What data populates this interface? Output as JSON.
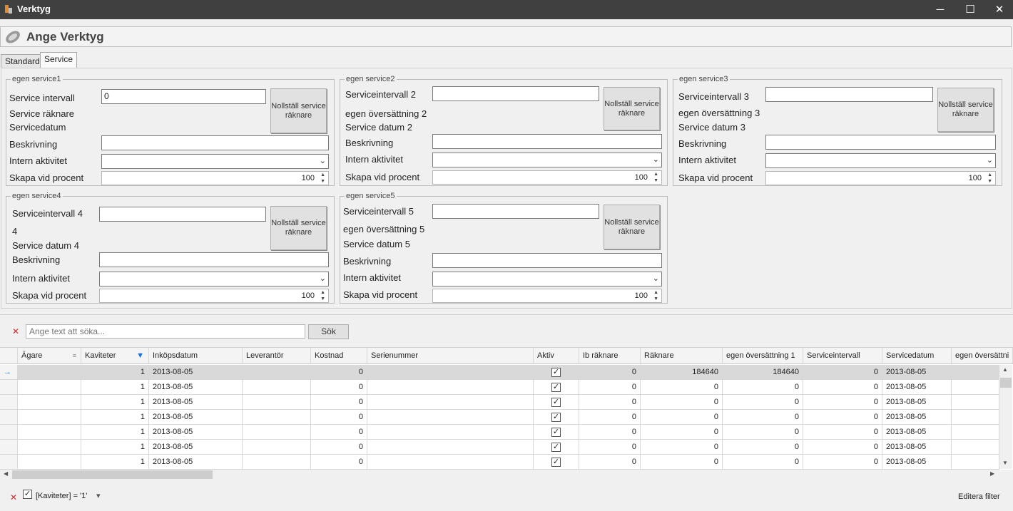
{
  "window": {
    "title": "Verktyg",
    "minimize": "─",
    "maximize": "☐",
    "close": "✕"
  },
  "header": {
    "title": "Ange Verktyg"
  },
  "tabs": [
    {
      "label": "Standard",
      "active": false
    },
    {
      "label": "Service",
      "active": true
    }
  ],
  "groups": {
    "g1": {
      "legend": "egen service1",
      "interval_label": "Service intervall",
      "interval_value": "0",
      "counter_label": "Service räknare",
      "date_label": "Servicedatum",
      "desc_label": "Beskrivning",
      "activity_label": "Intern aktivitet",
      "percent_label": "Skapa vid procent",
      "percent_value": "100",
      "reset_button": "Nollställ service räknare"
    },
    "g2": {
      "legend": "egen service2",
      "interval_label": "Serviceintervall 2",
      "interval_value": "",
      "counter_label": "egen översättning 2",
      "date_label": "Service datum 2",
      "desc_label": "Beskrivning",
      "activity_label": "Intern aktivitet",
      "percent_label": "Skapa vid procent",
      "percent_value": "100",
      "reset_button": "Nollställ service räknare"
    },
    "g3": {
      "legend": "egen service3",
      "interval_label": "Serviceintervall 3",
      "interval_value": "",
      "counter_label": "egen översättning 3",
      "date_label": "Service datum 3",
      "desc_label": "Beskrivning",
      "activity_label": "Intern aktivitet",
      "percent_label": "Skapa vid procent",
      "percent_value": "100",
      "reset_button": "Nollställ service räknare"
    },
    "g4": {
      "legend": "egen service4",
      "interval_label": "Serviceintervall 4",
      "interval_value": "",
      "counter_label": "4",
      "date_label": "Service datum 4",
      "desc_label": "Beskrivning",
      "activity_label": "Intern aktivitet",
      "percent_label": "Skapa vid procent",
      "percent_value": "100",
      "reset_button": "Nollställ service räknare"
    },
    "g5": {
      "legend": "egen service5",
      "interval_label": "Serviceintervall 5",
      "interval_value": "",
      "counter_label": "egen översättning 5",
      "date_label": "Service datum 5",
      "desc_label": "Beskrivning",
      "activity_label": "Intern aktivitet",
      "percent_label": "Skapa vid procent",
      "percent_value": "100",
      "reset_button": "Nollställ service räknare"
    }
  },
  "search": {
    "placeholder": "Ange text att söka...",
    "button": "Sök",
    "clear_icon": "✕"
  },
  "grid": {
    "columns": [
      "Ägare",
      "Kaviteter",
      "Inköpsdatum",
      "Leverantör",
      "Kostnad",
      "Serienummer",
      "Aktiv",
      "Ib räknare",
      "Räknare",
      "egen översättning 1",
      "Serviceintervall",
      "Servicedatum",
      "egen översättni"
    ],
    "rows": [
      {
        "agare": "",
        "kaviteter": "1",
        "inkopsdatum": "2013-08-05",
        "leverantor": "",
        "kostnad": "0",
        "serienummer": "",
        "aktiv": true,
        "ib": "0",
        "raknare": "184640",
        "egen1": "184640",
        "interval": "0",
        "servicedatum": "2013-08-05",
        "egen2": ""
      },
      {
        "agare": "",
        "kaviteter": "1",
        "inkopsdatum": "2013-08-05",
        "leverantor": "",
        "kostnad": "0",
        "serienummer": "",
        "aktiv": true,
        "ib": "0",
        "raknare": "0",
        "egen1": "0",
        "interval": "0",
        "servicedatum": "2013-08-05",
        "egen2": ""
      },
      {
        "agare": "",
        "kaviteter": "1",
        "inkopsdatum": "2013-08-05",
        "leverantor": "",
        "kostnad": "0",
        "serienummer": "",
        "aktiv": true,
        "ib": "0",
        "raknare": "0",
        "egen1": "0",
        "interval": "0",
        "servicedatum": "2013-08-05",
        "egen2": ""
      },
      {
        "agare": "",
        "kaviteter": "1",
        "inkopsdatum": "2013-08-05",
        "leverantor": "",
        "kostnad": "0",
        "serienummer": "",
        "aktiv": true,
        "ib": "0",
        "raknare": "0",
        "egen1": "0",
        "interval": "0",
        "servicedatum": "2013-08-05",
        "egen2": ""
      },
      {
        "agare": "",
        "kaviteter": "1",
        "inkopsdatum": "2013-08-05",
        "leverantor": "",
        "kostnad": "0",
        "serienummer": "",
        "aktiv": true,
        "ib": "0",
        "raknare": "0",
        "egen1": "0",
        "interval": "0",
        "servicedatum": "2013-08-05",
        "egen2": ""
      },
      {
        "agare": "",
        "kaviteter": "1",
        "inkopsdatum": "2013-08-05",
        "leverantor": "",
        "kostnad": "0",
        "serienummer": "",
        "aktiv": true,
        "ib": "0",
        "raknare": "0",
        "egen1": "0",
        "interval": "0",
        "servicedatum": "2013-08-05",
        "egen2": ""
      },
      {
        "agare": "",
        "kaviteter": "1",
        "inkopsdatum": "2013-08-05",
        "leverantor": "",
        "kostnad": "0",
        "serienummer": "",
        "aktiv": true,
        "ib": "0",
        "raknare": "0",
        "egen1": "0",
        "interval": "0",
        "servicedatum": "2013-08-05",
        "egen2": ""
      }
    ],
    "current_row_icon": "→"
  },
  "filter": {
    "text": "[Kaviteter] = '1'",
    "edit_label": "Editera filter",
    "clear_icon": "✕",
    "dropdown_icon": "▾"
  },
  "colors": {
    "titlebar": "#404040",
    "accent": "#1e6fd9",
    "clear": "#d62828"
  }
}
